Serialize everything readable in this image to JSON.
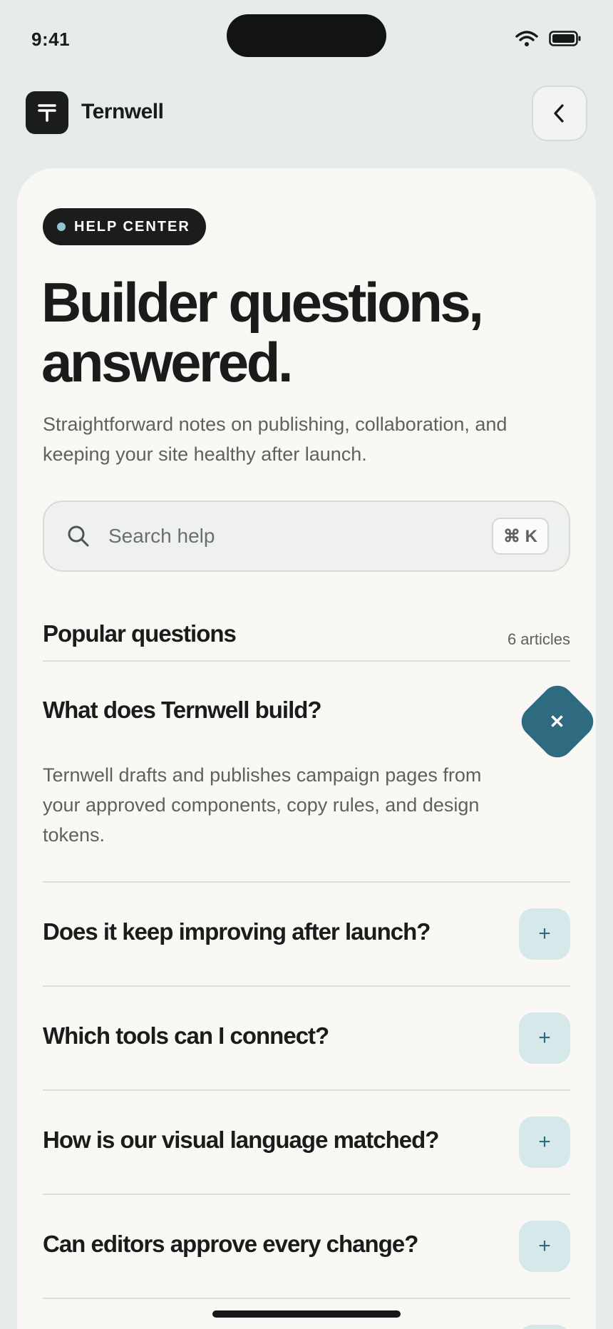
{
  "status_bar": {
    "time": "9:41"
  },
  "header": {
    "brand": "Ternwell",
    "logo_glyph": "T",
    "back_icon": "chevron-left-icon"
  },
  "hero": {
    "badge": "HELP CENTER",
    "title_line1": "Builder questions,",
    "title_line2": "answered.",
    "subtitle": "Straightforward notes on publishing, collaboration, and keeping your site healthy after launch."
  },
  "search": {
    "placeholder": "Search help",
    "shortcut": "⌘ K"
  },
  "section": {
    "title": "Popular questions",
    "count": "6 articles"
  },
  "faq": [
    {
      "question": "What does Ternwell build?",
      "expanded": true,
      "answer": "Ternwell drafts and publishes campaign pages from your approved components, copy rules, and design tokens."
    },
    {
      "question": "Does it keep improving after launch?",
      "expanded": false
    },
    {
      "question": "Which tools can I connect?",
      "expanded": false
    },
    {
      "question": "How is our visual language matched?",
      "expanded": false
    },
    {
      "question": "Can editors approve every change?",
      "expanded": false
    }
  ],
  "toggle_glyphs": {
    "open": "✕",
    "closed": "+"
  },
  "colors": {
    "accent": "#2e6a80",
    "accent_soft": "#d6e8ea",
    "dark": "#1b1d1c",
    "dot": "#8fc7cd"
  }
}
